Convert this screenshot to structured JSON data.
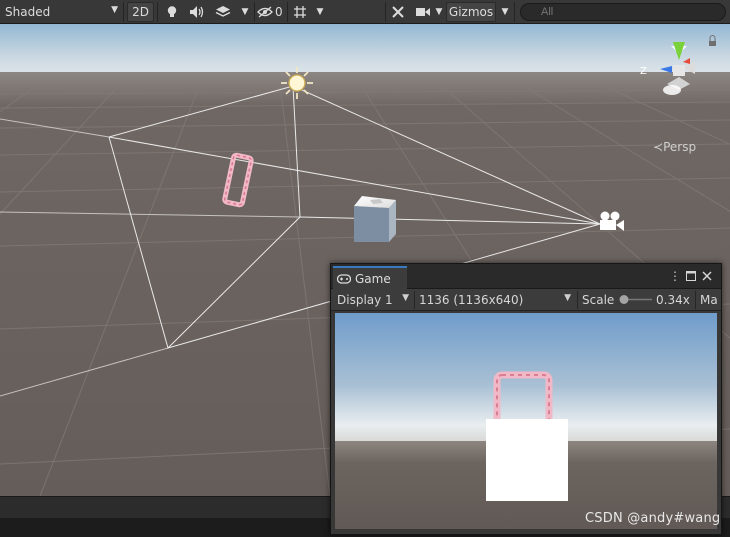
{
  "toolbar": {
    "shading_mode": "Shaded",
    "mode_2d": "2D",
    "hidden_count": "0",
    "gizmos_label": "Gizmos",
    "search_placeholder": "All"
  },
  "scene": {
    "projection_label": "Persp",
    "gizmo_axis_z": "Z",
    "colors": {
      "sky_top": "#8fb6d6",
      "horizon": "#dfe8ee",
      "ground": "#6a625d",
      "grid": "#837b76",
      "frustum": "#e6e6e6"
    }
  },
  "game_window": {
    "tab_title": "Game",
    "display_select": "Display 1",
    "resolution_select": "1136 (1136x640)",
    "scale_label": "Scale",
    "scale_value": "0.34x",
    "truncated_option": "Ma",
    "scale_level": 0.0
  },
  "watermark": "CSDN @andy#wang"
}
